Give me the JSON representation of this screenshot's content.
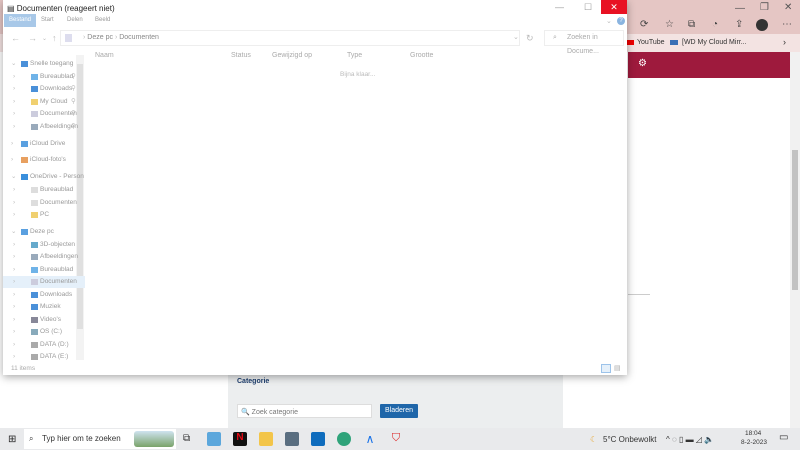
{
  "explorer": {
    "title": "Documenten (reageert niet)",
    "ribbon_tabs": [
      "Bestand",
      "Start",
      "Delen",
      "Beeld"
    ],
    "breadcrumb": [
      "Deze pc",
      "Documenten"
    ],
    "search_placeholder": "Zoeken in Docume...",
    "columns": [
      "Naam",
      "Status",
      "Gewijzigd op",
      "Type",
      "Grootte"
    ],
    "loading": "Bijna klaar...",
    "tree": [
      {
        "label": "Snelle toegang",
        "level": 0,
        "icon": "star-icon",
        "color": "#4a90d9"
      },
      {
        "label": "Bureaublad",
        "level": 1,
        "icon": "desktop-icon",
        "color": "#6fb3e8",
        "pin": true
      },
      {
        "label": "Downloads",
        "level": 1,
        "icon": "download-icon",
        "color": "#4a90d9",
        "pin": true
      },
      {
        "label": "My Cloud",
        "level": 1,
        "icon": "folder-icon",
        "color": "#f0d070",
        "pin": true
      },
      {
        "label": "Documenten",
        "level": 1,
        "icon": "document-icon",
        "color": "#ccd",
        "pin": true
      },
      {
        "label": "Afbeeldingen",
        "level": 1,
        "icon": "pictures-icon",
        "color": "#9ab",
        "pin": true
      },
      {
        "label": "iCloud Drive",
        "level": 0,
        "icon": "cloud-icon",
        "color": "#5aa0e0"
      },
      {
        "label": "iCloud-foto's",
        "level": 0,
        "icon": "photos-icon",
        "color": "#e8a060"
      },
      {
        "label": "OneDrive - Person",
        "level": 0,
        "icon": "onedrive-icon",
        "color": "#3a8fdc"
      },
      {
        "label": "Bureaublad",
        "level": 1,
        "icon": "folder-icon",
        "color": "#ddd"
      },
      {
        "label": "Documenten",
        "level": 1,
        "icon": "folder-icon",
        "color": "#ddd"
      },
      {
        "label": "PC",
        "level": 1,
        "icon": "folder-icon",
        "color": "#f0d070"
      },
      {
        "label": "Deze pc",
        "level": 0,
        "icon": "computer-icon",
        "color": "#5aa0e0"
      },
      {
        "label": "3D-objecten",
        "level": 1,
        "icon": "cube-icon",
        "color": "#6ac"
      },
      {
        "label": "Afbeeldingen",
        "level": 1,
        "icon": "pictures-icon",
        "color": "#9ab"
      },
      {
        "label": "Bureaublad",
        "level": 1,
        "icon": "desktop-icon",
        "color": "#6fb3e8"
      },
      {
        "label": "Documenten",
        "level": 1,
        "icon": "document-icon",
        "color": "#ccd",
        "selected": true
      },
      {
        "label": "Downloads",
        "level": 1,
        "icon": "download-icon",
        "color": "#4a90d9"
      },
      {
        "label": "Muziek",
        "level": 1,
        "icon": "music-icon",
        "color": "#4a90d9"
      },
      {
        "label": "Video's",
        "level": 1,
        "icon": "video-icon",
        "color": "#889"
      },
      {
        "label": "OS (C:)",
        "level": 1,
        "icon": "drive-icon",
        "color": "#8ab"
      },
      {
        "label": "DATA (D:)",
        "level": 1,
        "icon": "drive-icon",
        "color": "#aaa"
      },
      {
        "label": "DATA (E:)",
        "level": 1,
        "icon": "drive-icon",
        "color": "#aaa"
      }
    ],
    "item_count": "11 items"
  },
  "browser": {
    "bookmarks": [
      "YouTube",
      "[WD My Cloud Mirr..."
    ],
    "category_label": "Categorie",
    "category_placeholder": "Zoek categorie",
    "browse_button": "Bladeren",
    "accent": "#9e1a3d"
  },
  "taskbar": {
    "search_placeholder": "Typ hier om te zoeken",
    "weather": "5°C  Onbewolkt",
    "time": "18:04",
    "date": "8-2-2023"
  }
}
